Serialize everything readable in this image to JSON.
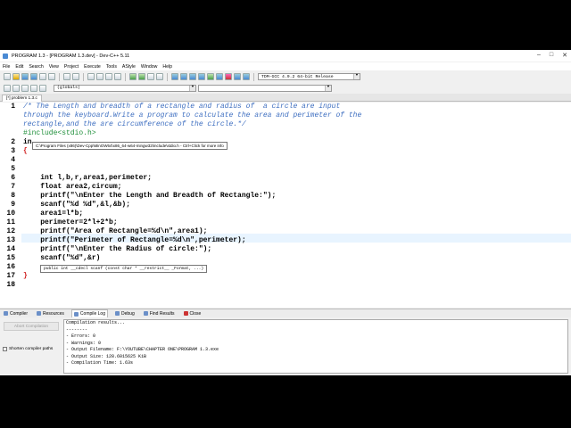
{
  "window": {
    "title": "PROGRAM 1.3 - [PROGRAM 1.3.dev] - Dev-C++ 5.11"
  },
  "menu": [
    "File",
    "Edit",
    "Search",
    "View",
    "Project",
    "Execute",
    "Tools",
    "AStyle",
    "Window",
    "Help"
  ],
  "toolbar": {
    "compiler_select": "TDM-GCC 4.9.2 64-bit Release",
    "scope_select": "(globals)"
  },
  "editor": {
    "tab_label": "[*] problem 1.3.c",
    "lines": [
      {
        "n": "1",
        "t": "/* The Length and breadth of a rectangle and radius of  a circle are input"
      },
      {
        "n": "",
        "t": "through the keyboard.Write a program to calculate the area and perimeter of the"
      },
      {
        "n": "",
        "t": "rectangle,and the are circumference of the circle.*/"
      },
      {
        "n": "2",
        "t": "#include<stdio.h>"
      },
      {
        "n": "3",
        "t": "in"
      },
      {
        "n": "4",
        "t": "{"
      },
      {
        "n": "5",
        "t": ""
      },
      {
        "n": "6",
        "t": ""
      },
      {
        "n": "7",
        "t": "    int l,b,r,area1,perimeter;"
      },
      {
        "n": "8",
        "t": "    float area2,circum;"
      },
      {
        "n": "9",
        "t": "    printf(\"\\nEnter the Length and Breadth of Rectangle:\");"
      },
      {
        "n": "10",
        "t": "    scanf(\"%d %d\",&l,&b);"
      },
      {
        "n": "11",
        "t": "    area1=l*b;"
      },
      {
        "n": "12",
        "t": "    perimeter=2*l+2*b;"
      },
      {
        "n": "13",
        "t": "    printf(\"Area of Rectangle=%d\\n\",area1);"
      },
      {
        "n": "14",
        "t": "    printf(\"Perimeter of Rectangle=%d\\n\",perimeter);"
      },
      {
        "n": "15",
        "t": "    printf(\"\\nEnter the Radius of circle:\");"
      },
      {
        "n": "16",
        "t": "    scanf(\"%d\",&r)"
      },
      {
        "n": "17",
        "t": ""
      },
      {
        "n": "18",
        "t": "}"
      }
    ],
    "include_tooltip": "C:\\Program Files (x86)\\Dev-Cpp\\MinGW64\\x86_64-w64-mingw32\\include\\stdio.h  -  Ctrl+Click for more info",
    "scanf_tooltip": "public int __cdecl scanf (const char * __restrict__ _Format, ...)"
  },
  "bottom_tabs": [
    "Compiler",
    "Resources",
    "Compile Log",
    "Debug",
    "Find Results",
    "Close"
  ],
  "bottom_active_tab": "Compile Log",
  "bottom_panel": {
    "abort_label": "Abort Compilation",
    "shorten_label": "Shorten compiler paths",
    "log": [
      "Compilation results...",
      "--------",
      "- Errors: 0",
      "- Warnings: 0",
      "- Output Filename: F:\\YOUTUBE\\CHAPTER ONE\\PROGRAM 1.3.exe",
      "- Output Size: 128.6015625 KiB",
      "- Compilation Time: 1.63s"
    ]
  }
}
